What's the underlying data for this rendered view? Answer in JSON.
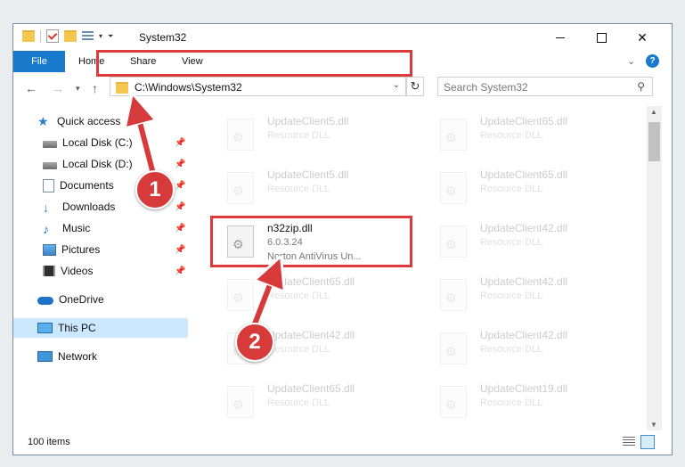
{
  "window": {
    "title": "System32",
    "qat_icons": [
      "folder-icon",
      "properties-check-icon",
      "new-folder-icon",
      "properties-icon"
    ]
  },
  "ribbon": {
    "tabs": [
      {
        "label": "File",
        "active": true
      },
      {
        "label": "Home"
      },
      {
        "label": "Share"
      },
      {
        "label": "View"
      }
    ],
    "accent": "#1979ca"
  },
  "address": {
    "path": "C:\\Windows\\System32",
    "search_placeholder": "Search System32"
  },
  "sidebar": {
    "items": [
      {
        "label": "Quick access",
        "icon": "star-icon"
      },
      {
        "label": "Local Disk (C:)",
        "icon": "disk-icon",
        "pinned": true
      },
      {
        "label": "Local Disk (D:)",
        "icon": "disk-icon",
        "pinned": true
      },
      {
        "label": "Documents",
        "icon": "document-icon",
        "pinned": true
      },
      {
        "label": "Downloads",
        "icon": "download-icon",
        "pinned": true
      },
      {
        "label": "Music",
        "icon": "music-icon",
        "pinned": true
      },
      {
        "label": "Pictures",
        "icon": "picture-icon",
        "pinned": true
      },
      {
        "label": "Videos",
        "icon": "video-icon",
        "pinned": true
      },
      {
        "label": "OneDrive",
        "icon": "cloud-icon"
      },
      {
        "label": "This PC",
        "icon": "pc-icon",
        "selected": true
      },
      {
        "label": "Network",
        "icon": "network-icon"
      }
    ]
  },
  "files": [
    {
      "name": "UpdateClient5.dll",
      "line2": "Resource DLL",
      "faded": true
    },
    {
      "name": "UpdateClient65.dll",
      "line2": "Resource DLL",
      "faded": true
    },
    {
      "name": "UpdateClient5.dll",
      "line2": "Resource DLL",
      "faded": true
    },
    {
      "name": "UpdateClient65.dll",
      "line2": "Resource DLL",
      "faded": true
    },
    {
      "name": "n32zip.dll",
      "line2": "6.0.3.24",
      "line3": "Norton AntiVirus Un...",
      "faded": false
    },
    {
      "name": "UpdateClient42.dll",
      "line2": "Resource DLL",
      "faded": true
    },
    {
      "name": "UpdateClient65.dll",
      "line2": "Resource DLL",
      "faded": true
    },
    {
      "name": "UpdateClient42.dll",
      "line2": "Resource DLL",
      "faded": true
    },
    {
      "name": "UpdateClient42.dll",
      "line2": "Resource DLL",
      "faded": true
    },
    {
      "name": "UpdateClient42.dll",
      "line2": "Resource DLL",
      "faded": true
    },
    {
      "name": "UpdateClient65.dll",
      "line2": "Resource DLL",
      "faded": true
    },
    {
      "name": "UpdateClient19.dll",
      "line2": "Resource DLL",
      "faded": true
    }
  ],
  "status": {
    "item_count": "100 items"
  },
  "callouts": {
    "step1": "1",
    "step2": "2",
    "color": "#d73a3a"
  }
}
